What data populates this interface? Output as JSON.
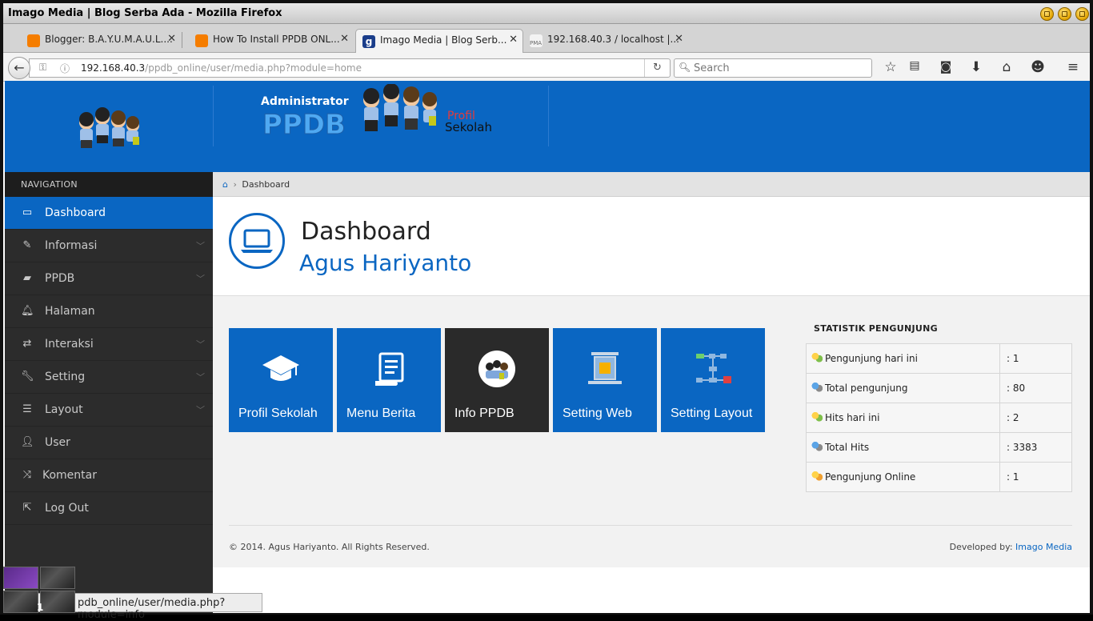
{
  "browser": {
    "window_title": "Imago Media | Blog Serba Ada - Mozilla Firefox",
    "tabs": [
      {
        "label": "Blogger: B.A.Y.U.M.A.U.L....",
        "icon": "blogger-icon"
      },
      {
        "label": "How To Install PPDB ONL...",
        "icon": "blogger-icon"
      },
      {
        "label": "Imago Media | Blog Serb...",
        "icon": "imago-icon"
      },
      {
        "label": "192.168.40.3 / localhost |...",
        "icon": "phpmyadmin-icon"
      }
    ],
    "url_host": "192.168.40.3",
    "url_path": "/ppdb_online/user/media.php?module=home",
    "search_placeholder": "Search",
    "status_url": "pdb_online/user/media.php?module=info"
  },
  "header": {
    "admin_text": "Administrator",
    "ppdb_text": "PPDB",
    "profil_text": "Profil",
    "sekolah_text": "Sekolah"
  },
  "sidebar": {
    "heading": "NAVIGATION",
    "items": [
      {
        "label": "Dashboard",
        "icon": "laptop-icon",
        "active": true
      },
      {
        "label": "Informasi",
        "icon": "pencil-icon"
      },
      {
        "label": "PPDB",
        "icon": "book-icon"
      },
      {
        "label": "Halaman",
        "icon": "bell-icon"
      },
      {
        "label": "Interaksi",
        "icon": "retweet-icon"
      },
      {
        "label": "Setting",
        "icon": "wrench-icon"
      },
      {
        "label": "Layout",
        "icon": "list-icon"
      },
      {
        "label": "User",
        "icon": "user-icon"
      },
      {
        "label": "Komentar",
        "icon": "shuffle-icon"
      },
      {
        "label": "Log Out",
        "icon": "logout-icon"
      }
    ]
  },
  "breadcrumb": {
    "current": "Dashboard"
  },
  "page_header": {
    "title": "Dashboard",
    "subtitle": "Agus Hariyanto"
  },
  "tiles": [
    {
      "label": "Profil Sekolah",
      "icon": "graduation-cap-icon"
    },
    {
      "label": "Menu Berita",
      "icon": "scroll-icon"
    },
    {
      "label": "Info PPDB",
      "icon": "ppdb-logo-icon"
    },
    {
      "label": "Setting Web",
      "icon": "web-settings-icon"
    },
    {
      "label": "Setting Layout",
      "icon": "layout-flow-icon"
    }
  ],
  "stats": {
    "heading": "STATISTIK PENGUNJUNG",
    "rows": [
      {
        "label": "Pengunjung hari ini",
        "value": ": 1"
      },
      {
        "label": "Total pengunjung",
        "value": ": 80"
      },
      {
        "label": "Hits hari ini",
        "value": ": 2"
      },
      {
        "label": "Total Hits",
        "value": ": 3383"
      },
      {
        "label": "Pengunjung Online",
        "value": ": 1"
      }
    ]
  },
  "footer": {
    "copyright": "© 2014. Agus Hariyanto. All Rights Reserved.",
    "dev_label": "Developed by:",
    "dev_link": "Imago Media"
  },
  "taskbar": {
    "badge": "1"
  },
  "colors": {
    "primary": "#0a66c2",
    "sidebar": "#2c2c2c",
    "dark_tile": "#2a2a2a"
  }
}
